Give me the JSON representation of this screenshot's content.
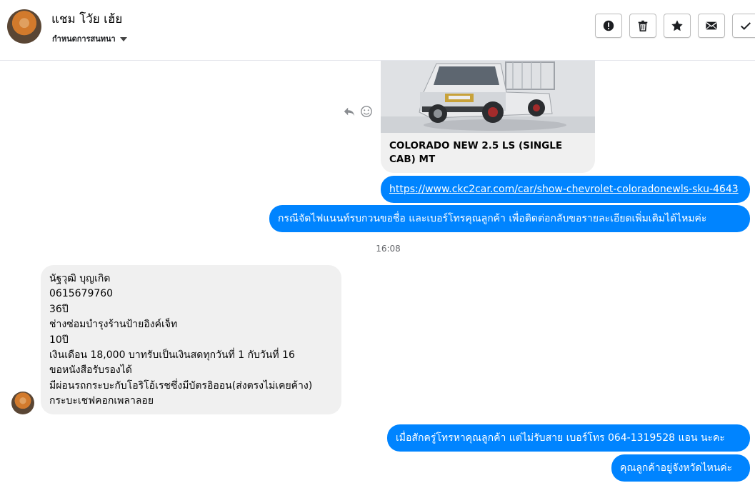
{
  "header": {
    "name": "แชม โวัย เฮ้ย",
    "status": "กำหนดการสนทนา",
    "buttons": [
      {
        "icon": "alert-icon"
      },
      {
        "icon": "trash-icon"
      },
      {
        "icon": "star-icon"
      },
      {
        "icon": "envelope-icon"
      },
      {
        "icon": "check-icon"
      }
    ]
  },
  "messages": {
    "card_title": "COLORADO NEW 2.5 LS (SINGLE CAB) MT",
    "link": "https://www.ckc2car.com/car/show-chevrolet-coloradonewls-sku-4643",
    "out1": "กรณีจัดไฟแนนท์รบกวนขอชื่อ และเบอร์โทรคุณลูกค้า เพื่อติดต่อกลับขอรายละเอียดเพิ่มเติมได้ไหมค่ะ",
    "timestamp": "16:08",
    "in_lines": [
      "นัฐวุฒิ บุญเกิด",
      "0615679760",
      "36ปี",
      "ช่างซ่อมบำรุงร้านป้ายอิงค์เจ็ท",
      "10ปี",
      "เงินเดือน 18,000 บาทรับเป็นเงินสดทุกวันที่ 1 กับวันที่ 16",
      "ขอหนังสือรับรองได้",
      "มีผ่อนรถกระบะกับโอริโอ้เรชซึ่งมีบัตรอิออน(ส่งตรงไม่เคยค้าง)",
      "กระบะเชฟคอกเพลาลอย"
    ],
    "out2": "เมื่อสักครู่โทรหาคุณลูกค้า แต่ไม่รับสาย เบอร์โทร 064-1319528 แอน นะคะ",
    "out3": "คุณลูกค้าอยู่จังหวัดไหนค่ะ"
  },
  "colors": {
    "accent": "#0084ff",
    "incoming_bubble": "#f0f0f0",
    "timestamp": "#65676b"
  }
}
